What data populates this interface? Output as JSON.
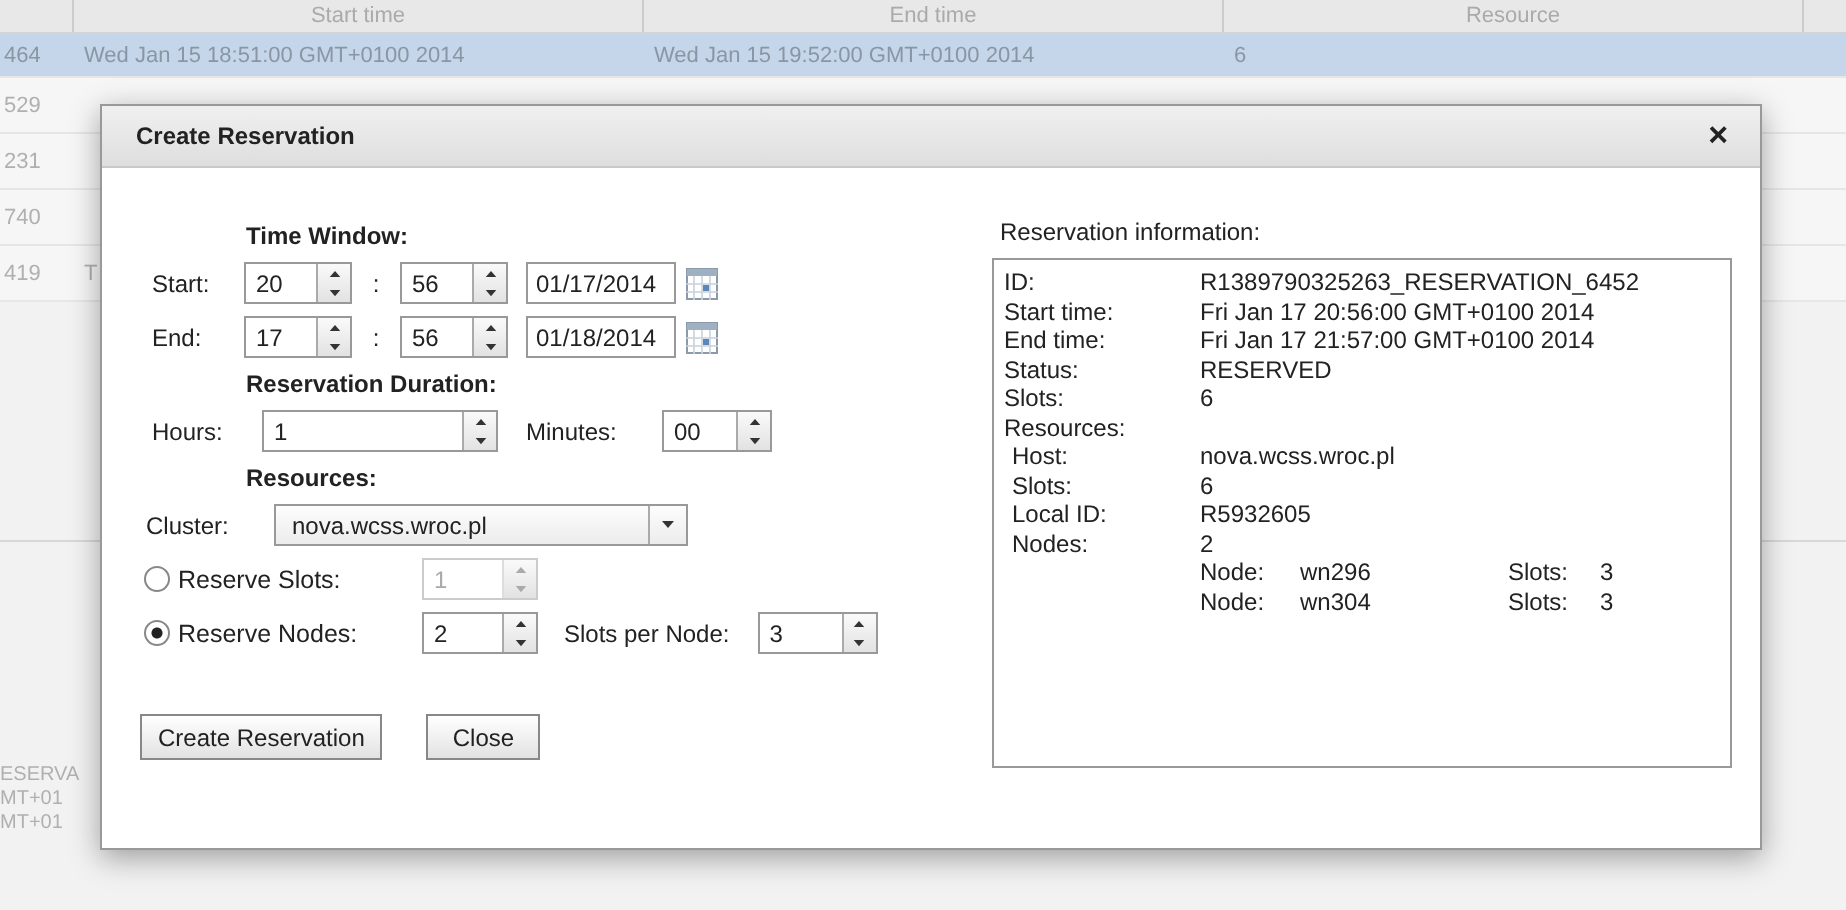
{
  "background_table": {
    "columns": [
      "Start time",
      "End time",
      "Resource"
    ],
    "rows": [
      {
        "id": "464",
        "start": "Wed Jan 15 18:51:00 GMT+0100 2014",
        "end": "Wed Jan 15 19:52:00 GMT+0100 2014",
        "resource": "6",
        "selected": true
      },
      {
        "id": "529",
        "selected": false
      },
      {
        "id": "231",
        "selected": false
      },
      {
        "id": "740",
        "selected": false
      },
      {
        "id": "419",
        "start": "T",
        "selected": false
      }
    ]
  },
  "background_lower": {
    "lines": [
      "ESERVA",
      "MT+01",
      "MT+01"
    ]
  },
  "dialog": {
    "title": "Create Reservation",
    "close": "×",
    "time_window": {
      "heading": "Time Window:",
      "rows": [
        {
          "label": "Start:",
          "hour": "20",
          "separator": ":",
          "minute": "56",
          "date": "01/17/2014"
        },
        {
          "label": "End:",
          "hour": "17",
          "separator": ":",
          "minute": "56",
          "date": "01/18/2014"
        }
      ]
    },
    "duration": {
      "heading": "Reservation Duration:",
      "hours_label": "Hours:",
      "hours": "1",
      "minutes_label": "Minutes:",
      "minutes": "00"
    },
    "resources": {
      "heading": "Resources:",
      "cluster_label": "Cluster:",
      "cluster": "nova.wcss.wroc.pl",
      "options": [
        {
          "label": "Reserve Slots:",
          "selected": false,
          "value": "1",
          "disabled": true
        },
        {
          "label": "Reserve Nodes:",
          "selected": true,
          "value": "2",
          "disabled": false,
          "extra_label": "Slots per Node:",
          "extra_value": "3"
        }
      ]
    },
    "buttons": [
      "Create Reservation",
      "Close"
    ],
    "info": {
      "heading": "Reservation information:",
      "fields": [
        {
          "label": "ID:",
          "value": "R1389790325263_RESERVATION_6452"
        },
        {
          "label": "Start time:",
          "value": "Fri Jan 17 20:56:00 GMT+0100 2014"
        },
        {
          "label": "End time:",
          "value": "Fri Jan 17 21:57:00 GMT+0100 2014"
        },
        {
          "label": "Status:",
          "value": "RESERVED"
        },
        {
          "label": "Slots:",
          "value": "6"
        },
        {
          "label": "Resources:"
        }
      ],
      "resource_fields": [
        {
          "label": "Host:",
          "value": "nova.wcss.wroc.pl"
        },
        {
          "label": "Slots:",
          "value": "6"
        },
        {
          "label": "Local ID:",
          "value": "R5932605"
        },
        {
          "label": "Nodes:",
          "value": "2"
        }
      ],
      "nodes": [
        {
          "node_label": "Node:",
          "node": "wn296",
          "slots_label": "Slots:",
          "slots": "3"
        },
        {
          "node_label": "Node:",
          "node": "wn304",
          "slots_label": "Slots:",
          "slots": "3"
        }
      ]
    }
  }
}
